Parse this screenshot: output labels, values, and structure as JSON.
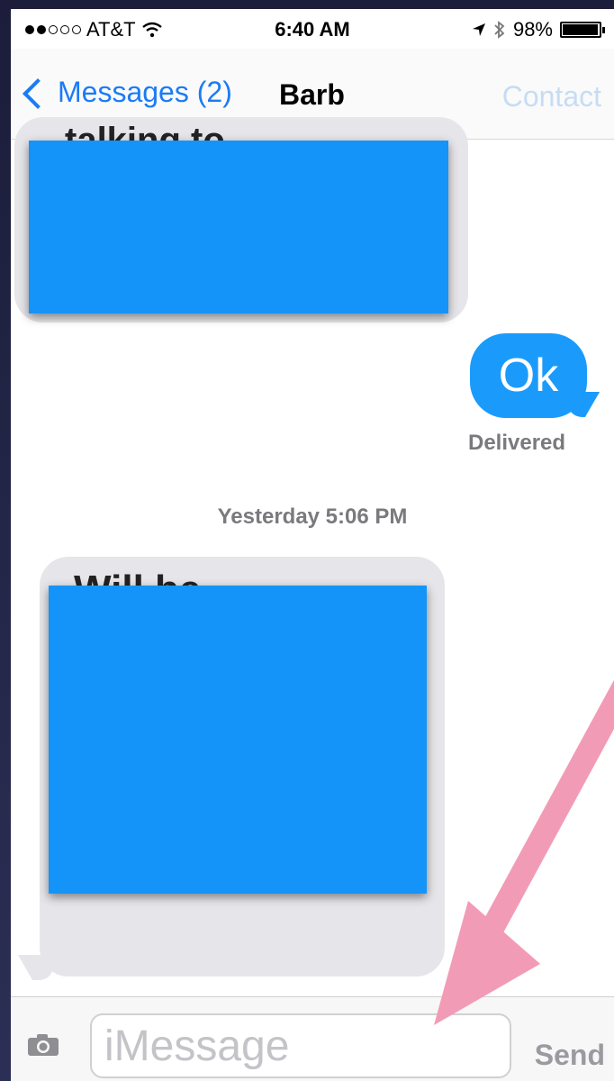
{
  "status_bar": {
    "carrier": "AT&T",
    "time": "6:40 AM",
    "battery": "98%",
    "battery_level": 0.98,
    "icons": [
      "signal-dots-icon",
      "wifi-icon",
      "location-arrow-icon",
      "bluetooth-icon",
      "battery-icon"
    ]
  },
  "nav": {
    "back_label": "Messages (2)",
    "title": "Barb",
    "contact_label": "Contact"
  },
  "conversation": {
    "message_1_partial": "talking to",
    "message_2_reply": "Ok",
    "delivery_status": "Delivered",
    "timestamp": "Yesterday 5:06 PM",
    "message_3_partial": "Will be"
  },
  "input_bar": {
    "placeholder": "iMessage",
    "send_label": "Send"
  },
  "colors": {
    "accent": "#1a7cf5",
    "sent_bubble": "#1a9bfb",
    "received_bubble": "#e6e6ea",
    "redaction": "#1494f8",
    "annotation_arrow": "#f29bb7"
  }
}
